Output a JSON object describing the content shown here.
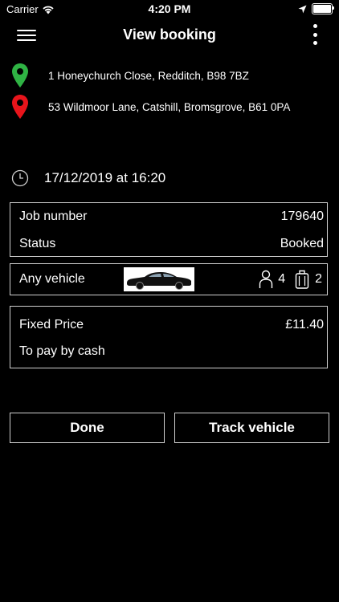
{
  "status_bar": {
    "carrier": "Carrier",
    "time": "4:20 PM"
  },
  "header": {
    "title": "View booking",
    "menu_icon": "hamburger-menu-icon",
    "more_icon": "vertical-ellipsis-icon"
  },
  "pickup": {
    "address": "1 Honeychurch Close, Redditch, B98 7BZ",
    "icon": "green-location-pin-icon",
    "color": "#2fb344"
  },
  "dropoff": {
    "address": "53 Wildmoor Lane, Catshill, Bromsgrove, B61 0PA",
    "icon": "red-location-pin-icon",
    "color": "#e8141b"
  },
  "pickup_time": {
    "icon": "clock-icon",
    "text": "17/12/2019 at 16:20"
  },
  "job": {
    "number_label": "Job number",
    "number_value": "179640",
    "status_label": "Status",
    "status_value": "Booked"
  },
  "vehicle": {
    "type": "Any vehicle",
    "image_icon": "car-icon",
    "passengers": "4",
    "luggage": "2"
  },
  "payment": {
    "price_label": "Fixed Price",
    "price_value": "£11.40",
    "method": "To pay by cash"
  },
  "actions": {
    "done": "Done",
    "track": "Track vehicle"
  }
}
